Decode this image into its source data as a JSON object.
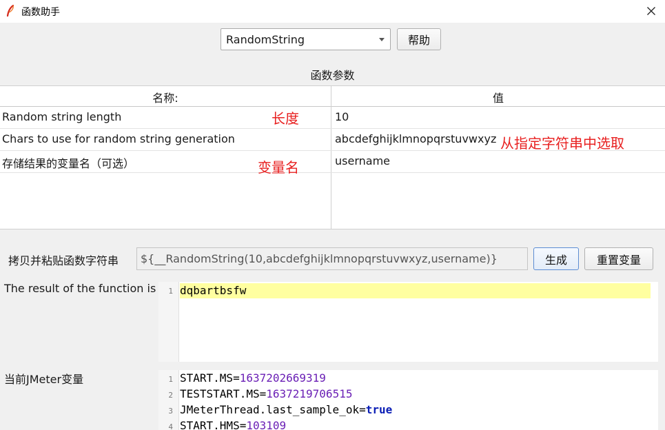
{
  "window": {
    "title": "函数助手"
  },
  "toolbar": {
    "function_selected": "RandomString",
    "help_label": "帮助"
  },
  "params": {
    "section_title": "函数参数",
    "headers": {
      "name": "名称:",
      "value": "值"
    },
    "rows": [
      {
        "name": "Random string length",
        "value": "10",
        "annotation": "长度"
      },
      {
        "name": "Chars to use for random string generation",
        "value": "abcdefghijklmnopqrstuvwxyz",
        "annotation": "从指定字符串中选取"
      },
      {
        "name": "存储结果的变量名（可选）",
        "value": "username",
        "annotation": "变量名"
      }
    ]
  },
  "function_string": {
    "label": "拷贝并粘贴函数字符串",
    "value": "${__RandomString(10,abcdefghijklmnopqrstuvwxyz,username)}",
    "generate_label": "生成",
    "reset_label": "重置变量"
  },
  "result": {
    "label": "The result of the function is",
    "line_number": "1",
    "text": "dqbartbsfw"
  },
  "variables": {
    "label": "当前JMeter变量",
    "lines": [
      {
        "n": "1",
        "key": "START.MS",
        "eq": "=",
        "val": "1637202669319"
      },
      {
        "n": "2",
        "key": "TESTSTART.MS",
        "eq": "=",
        "val": "1637219706515"
      },
      {
        "n": "3",
        "key": "JMeterThread.last_sample_ok",
        "eq": "=",
        "val": "true"
      },
      {
        "n": "4",
        "key": "START.HMS",
        "eq": "=",
        "val": "103109"
      }
    ]
  },
  "colors": {
    "annotation": "#e82020",
    "highlight": "#ffffa0",
    "number": "#6a1fb5",
    "keyword": "#0a1db5"
  },
  "icons": {
    "app": "feather-icon",
    "close": "close-icon",
    "dropdown": "chevron-down-icon"
  }
}
